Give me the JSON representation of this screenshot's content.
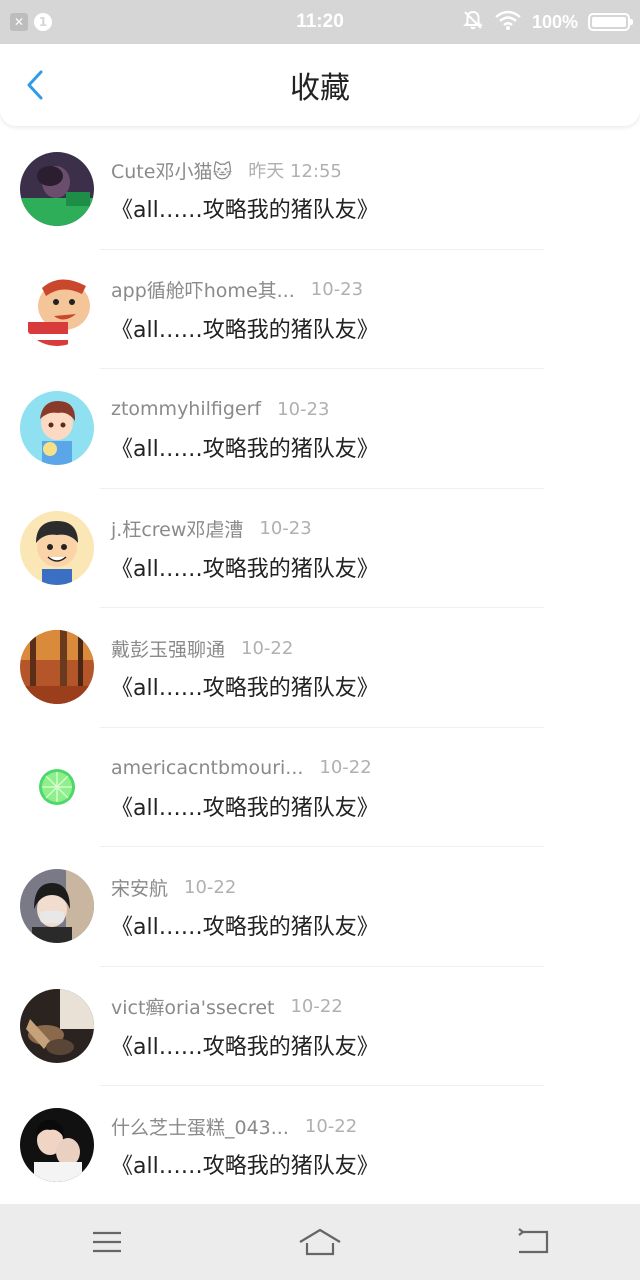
{
  "status_bar": {
    "notification_count": "1",
    "time": "11:20",
    "battery_text": "100%"
  },
  "header": {
    "title": "收藏"
  },
  "colors": {
    "accent": "#2f9be8",
    "status_bar_bg": "#d6d6d6",
    "nav_bar_bg": "#ececec"
  },
  "items": [
    {
      "username": "Cute邓小猫🐱",
      "time": "昨天 12:55",
      "title": "《all……攻略我的猪队友》",
      "avatar": "avatar-green-person"
    },
    {
      "username": "app循舱吓home其...",
      "time": "10-23",
      "title": "《all……攻略我的猪队友》",
      "avatar": "avatar-cartoon-redhead"
    },
    {
      "username": "ztommyhilfigerf",
      "time": "10-23",
      "title": "《all……攻略我的猪队友》",
      "avatar": "avatar-anime-boy"
    },
    {
      "username": "j.枉crew邓虐漕",
      "time": "10-23",
      "title": "《all……攻略我的猪队友》",
      "avatar": "avatar-cartoon-kid"
    },
    {
      "username": "戴彭玉强聊通",
      "time": "10-22",
      "title": "《all……攻略我的猪队友》",
      "avatar": "avatar-autumn-forest"
    },
    {
      "username": "americacntbmouri...",
      "time": "10-22",
      "title": "《all……攻略我的猪队友》",
      "avatar": "avatar-lime"
    },
    {
      "username": "宋安航",
      "time": "10-22",
      "title": "《all……攻略我的猪队友》",
      "avatar": "avatar-masked-girl"
    },
    {
      "username": "vict癣oria'ssecret",
      "time": "10-22",
      "title": "《all……攻略我的猪队友》",
      "avatar": "avatar-dark-photo"
    },
    {
      "username": "什么芝士蛋糕_043...",
      "time": "10-22",
      "title": "《all……攻略我的猪队友》",
      "avatar": "avatar-couple"
    }
  ]
}
